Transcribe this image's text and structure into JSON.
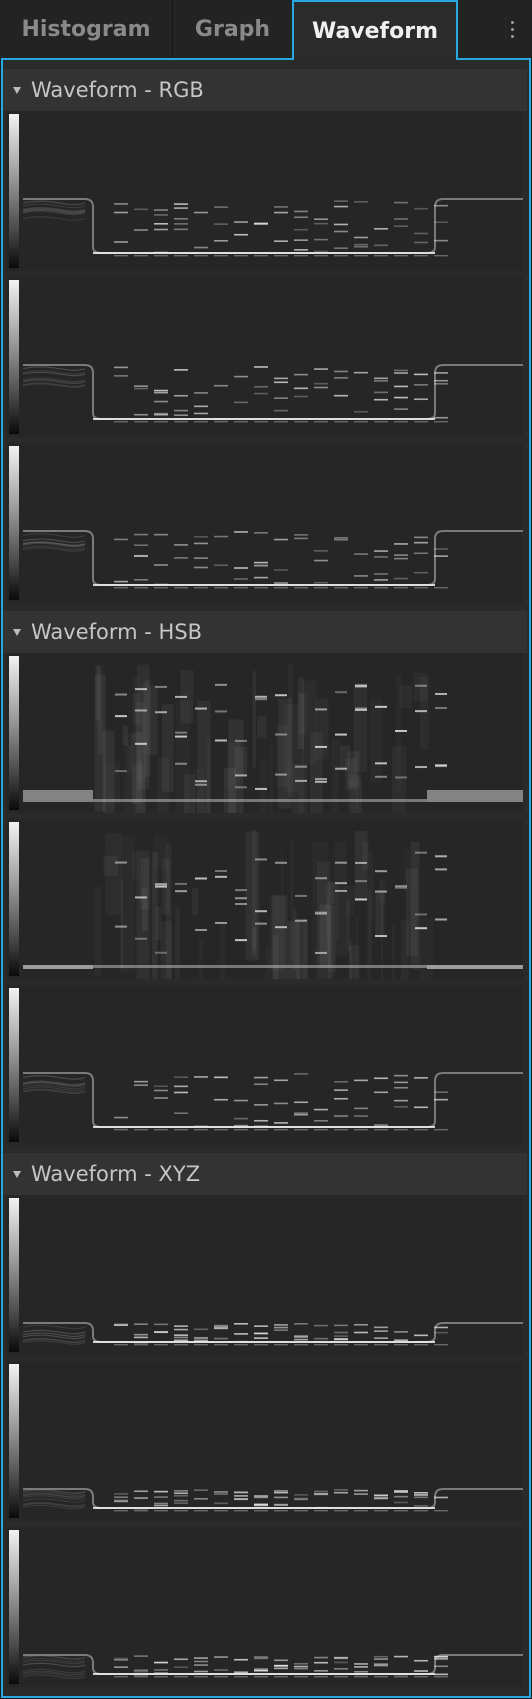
{
  "tabs": [
    {
      "label": "Histogram",
      "active": false
    },
    {
      "label": "Graph",
      "active": false
    },
    {
      "label": "Waveform",
      "active": true
    }
  ],
  "menu_icon": "more-vertical-icon",
  "accent_color": "#29a7e1",
  "sections": [
    {
      "title": "Waveform - RGB",
      "channels": 3
    },
    {
      "title": "Waveform - HSB",
      "channels": 3
    },
    {
      "title": "Waveform - XYZ",
      "channels": 3
    }
  ]
}
